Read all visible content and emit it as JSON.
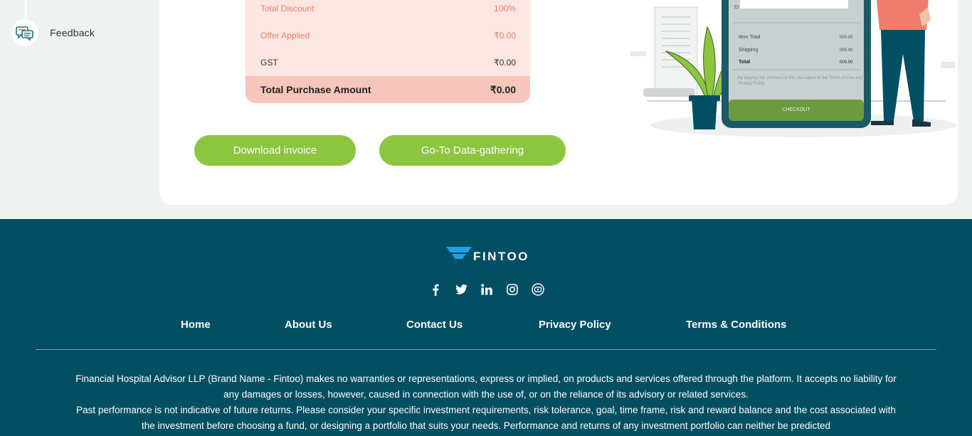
{
  "sidebar": {
    "feedback_label": "Feedback"
  },
  "summary": {
    "rows": [
      {
        "label": "Total Discount",
        "value": "100%"
      },
      {
        "label": "Offer Applied",
        "value": "₹0.00"
      },
      {
        "label": "GST",
        "value": "₹0.00"
      }
    ],
    "total_label": "Total Purchase Amount",
    "total_value": "₹0.00"
  },
  "buttons": {
    "download": "Download invoice",
    "go_to": "Go-To Data-gathering"
  },
  "illustration": {
    "item_total_label": "Item Total",
    "item_total_value": "000.00",
    "shipping_label": "Shipping",
    "shipping_value": "000.00",
    "total_label": "Total",
    "total_value": "000.00",
    "terms_text": "By tapping the checkout in this you agree to the Terms of Use and Privacy Policy",
    "checkout_label": "CHECKOUT",
    "colors": {
      "phone": "#1c5b66",
      "screen": "#c9d0d2",
      "checkout": "#6c9b3f",
      "plant": "#8cc63f",
      "shirt": "#ef7f6c"
    }
  },
  "footer": {
    "brand": "FINTOO",
    "socials": [
      "facebook-icon",
      "twitter-icon",
      "linkedin-icon",
      "instagram-icon",
      "youtube-icon"
    ],
    "links": [
      "Home",
      "About Us",
      "Contact Us",
      "Privacy Policy",
      "Terms & Conditions"
    ],
    "disclaimer_1": "Financial Hospital Advisor LLP (Brand Name - Fintoo) makes no warranties or representations, express or implied, on products and services offered through the platform. It accepts no liability for any damages or losses, however, caused in connection with the use of, or on the reliance of its advisory or related services.",
    "disclaimer_2": "Past performance is not indicative of future returns. Please consider your specific investment requirements, risk tolerance, goal, time frame, risk and reward balance and the cost associated with the investment before choosing a fund, or designing a portfolio that suits your needs. Performance and returns of any investment portfolio can neither be predicted"
  },
  "colors": {
    "accent": "#8cc63f",
    "footer_bg": "#024e62",
    "summary_bg": "#fbe6e2",
    "total_bg": "#f6c6bc",
    "discount_text": "#ef7f6c"
  }
}
